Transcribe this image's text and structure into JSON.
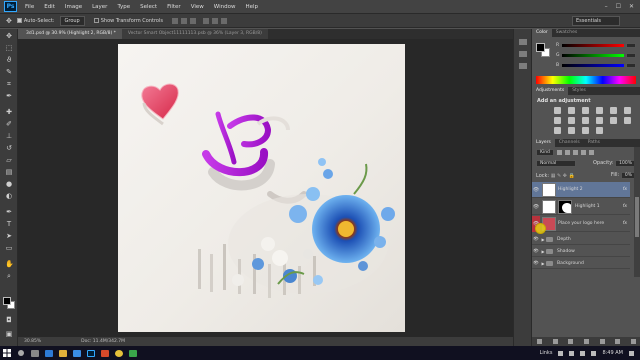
{
  "app": {
    "logo": "Ps"
  },
  "menu": [
    "File",
    "Edit",
    "Image",
    "Layer",
    "Type",
    "Select",
    "Filter",
    "View",
    "Window",
    "Help"
  ],
  "window_controls": {
    "minimize": "–",
    "maximize": "☐",
    "close": "✕"
  },
  "options_bar": {
    "auto_select_label": "Auto-Select:",
    "auto_select_checked": true,
    "auto_select_value": "Group",
    "show_transform_label": "Show Transform Controls",
    "show_transform_checked": false,
    "workspace": "Essentials"
  },
  "doc_tabs": [
    {
      "label": "3d1.psd @ 30.9% (Highlight 2, RGB/8) *",
      "active": true
    },
    {
      "label": "Vector Smart Object11111113.psb @ 36% (Layer 3, RGB/8)",
      "active": false
    }
  ],
  "status_bar": {
    "zoom": "30.85%",
    "doc": "Doc: 11.4M/342.7M"
  },
  "panels": {
    "color": {
      "tabs": [
        "Color",
        "Swatches"
      ],
      "rows": [
        {
          "label": "R",
          "colors": [
            "#000000",
            "#ff0000"
          ]
        },
        {
          "label": "G",
          "colors": [
            "#000000",
            "#00ff00"
          ]
        },
        {
          "label": "B",
          "colors": [
            "#000000",
            "#0000ff"
          ]
        }
      ]
    },
    "adjustments": {
      "tabs": [
        "Adjustments",
        "Styles"
      ],
      "title": "Add an adjustment"
    },
    "layers": {
      "tabs": [
        "Layers",
        "Channels",
        "Paths"
      ],
      "kind_filter": "Kind",
      "blend_mode": "Normal",
      "opacity_label": "Opacity:",
      "opacity_value": "100%",
      "lock_label": "Lock:",
      "fill_label": "Fill:",
      "fill_value": "0%",
      "items": [
        {
          "name": "Highlight 2",
          "fx": "fx",
          "selected": true
        },
        {
          "name": "Highlight 1",
          "fx": "fx",
          "selected": false
        },
        {
          "name": "Place your logo here",
          "fx": "fx",
          "selected": false
        }
      ],
      "groups": [
        "Depth",
        "Shadow",
        "Background"
      ]
    }
  },
  "taskbar": {
    "links_label": "Links",
    "time": "8:49 AM"
  },
  "colors": {
    "ui_dark": "#3c3c3c",
    "ui_mid": "#535353",
    "selection": "#617698",
    "accent_purple": "#b013d6",
    "heart_red": "#e23c5c",
    "flower_blue": "#4a8fe0"
  }
}
